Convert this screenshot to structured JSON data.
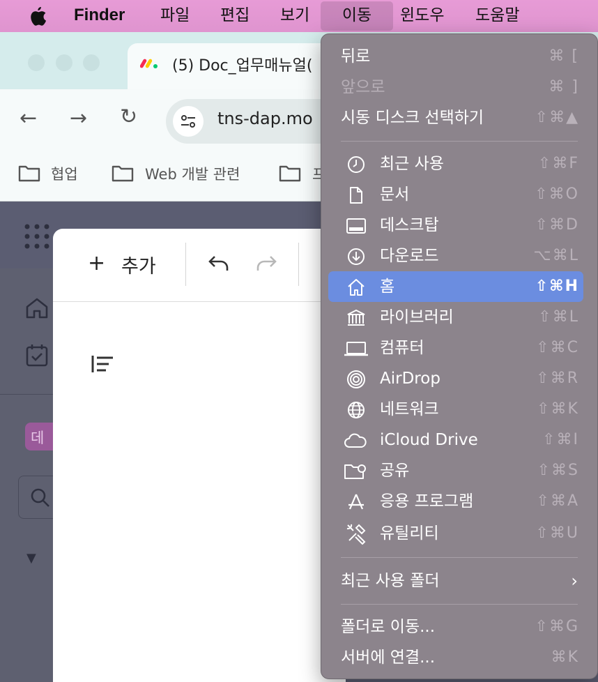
{
  "menubar": {
    "app": "Finder",
    "items": [
      "파일",
      "편집",
      "보기",
      "이동",
      "윈도우",
      "도움말"
    ]
  },
  "browser": {
    "tab_title": "(5) Doc_업무매뉴얼(",
    "url": "tns-dap.mo",
    "bookmarks": [
      "협업",
      "Web 개발 관련",
      "프"
    ]
  },
  "page": {
    "add_label": "추가",
    "side_badge": "데"
  },
  "go_menu": {
    "top": [
      {
        "label": "뒤로",
        "shortcut": "⌘ [",
        "enabled": true
      },
      {
        "label": "앞으로",
        "shortcut": "⌘ ]",
        "enabled": false
      },
      {
        "label": "시동 디스크 선택하기",
        "shortcut": "⇧⌘▲",
        "enabled": true
      }
    ],
    "places": [
      {
        "label": "최근 사용",
        "shortcut": "⇧⌘F",
        "icon": "clock-icon"
      },
      {
        "label": "문서",
        "shortcut": "⇧⌘O",
        "icon": "document-icon"
      },
      {
        "label": "데스크탑",
        "shortcut": "⇧⌘D",
        "icon": "desktop-icon"
      },
      {
        "label": "다운로드",
        "shortcut": "⌥⌘L",
        "icon": "download-icon"
      },
      {
        "label": "홈",
        "shortcut": "⇧⌘H",
        "icon": "home-icon",
        "highlighted": true
      },
      {
        "label": "라이브러리",
        "shortcut": "⇧⌘L",
        "icon": "library-icon"
      },
      {
        "label": "컴퓨터",
        "shortcut": "⇧⌘C",
        "icon": "laptop-icon"
      },
      {
        "label": "AirDrop",
        "shortcut": "⇧⌘R",
        "icon": "airdrop-icon"
      },
      {
        "label": "네트워크",
        "shortcut": "⇧⌘K",
        "icon": "network-icon"
      },
      {
        "label": "iCloud Drive",
        "shortcut": "⇧⌘I",
        "icon": "cloud-icon"
      },
      {
        "label": "공유",
        "shortcut": "⇧⌘S",
        "icon": "shared-folder-icon"
      },
      {
        "label": "응용 프로그램",
        "shortcut": "⇧⌘A",
        "icon": "applications-icon"
      },
      {
        "label": "유틸리티",
        "shortcut": "⇧⌘U",
        "icon": "utilities-icon"
      }
    ],
    "recent_folders": "최근 사용 폴더",
    "bottom": [
      {
        "label": "폴더로 이동...",
        "shortcut": "⇧⌘G"
      },
      {
        "label": "서버에 연결...",
        "shortcut": "⌘K"
      }
    ]
  },
  "colors": {
    "menubar": "#e79bd6",
    "menu_bg": "#8c848c",
    "highlight": "#6b8de0"
  }
}
